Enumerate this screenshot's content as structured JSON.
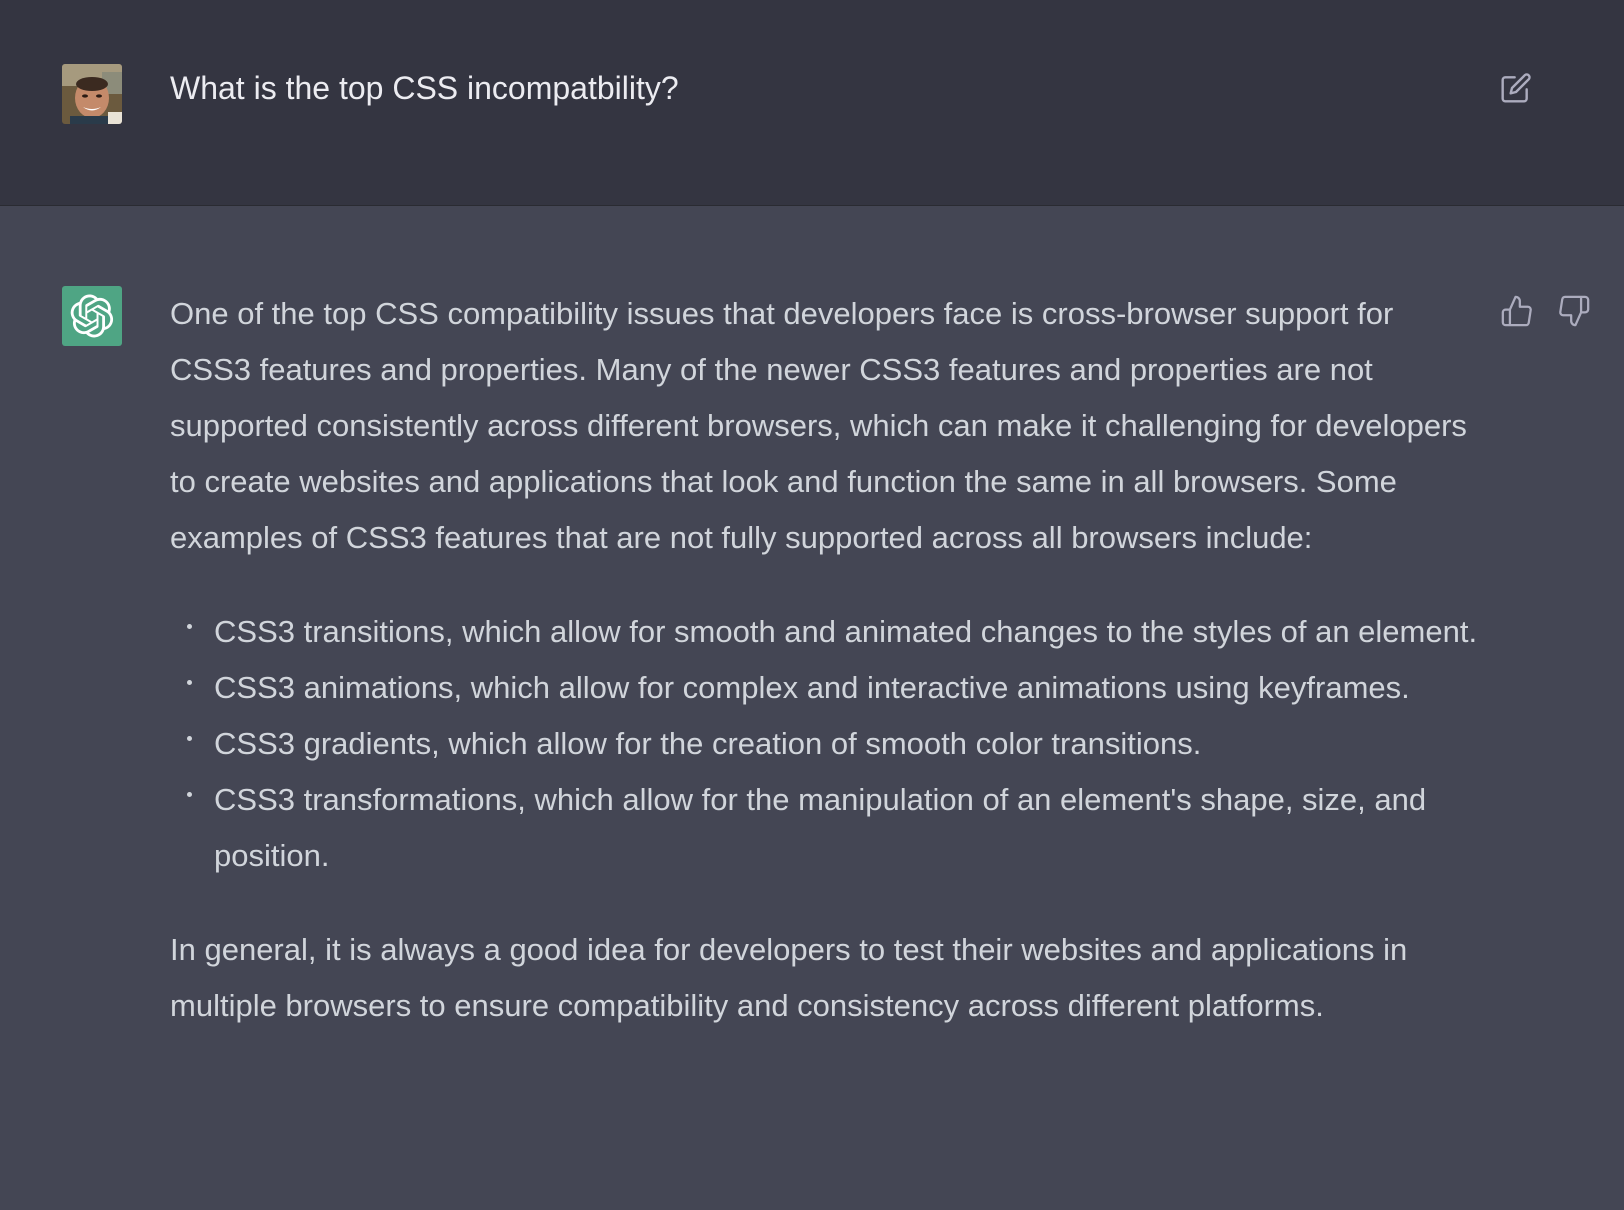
{
  "user_message": {
    "text": "What is the top CSS incompatbility?"
  },
  "assistant_message": {
    "intro": "One of the top CSS compatibility issues that developers face is cross-browser support for CSS3 features and properties. Many of the newer CSS3 features and properties are not supported consistently across different browsers, which can make it challenging for developers to create websites and applications that look and function the same in all browsers. Some examples of CSS3 features that are not fully supported across all browsers include:",
    "bullets": [
      "CSS3 transitions, which allow for smooth and animated changes to the styles of an element.",
      "CSS3 animations, which allow for complex and interactive animations using keyframes.",
      "CSS3 gradients, which allow for the creation of smooth color transitions.",
      "CSS3 transformations, which allow for the manipulation of an element's shape, size, and position."
    ],
    "conclusion": "In general, it is always a good idea for developers to test their websites and applications in multiple browsers to ensure compatibility and consistency across different platforms."
  },
  "icons": {
    "edit": "edit-pencil-icon",
    "thumbs_up": "thumbs-up-icon",
    "thumbs_down": "thumbs-down-icon",
    "assistant_logo": "openai-logo-icon",
    "user_avatar": "user-avatar-photo"
  },
  "colors": {
    "user_bg": "#343541",
    "assistant_bg": "#444654",
    "logo_bg": "#4fa584",
    "text": "#d1d5db"
  }
}
